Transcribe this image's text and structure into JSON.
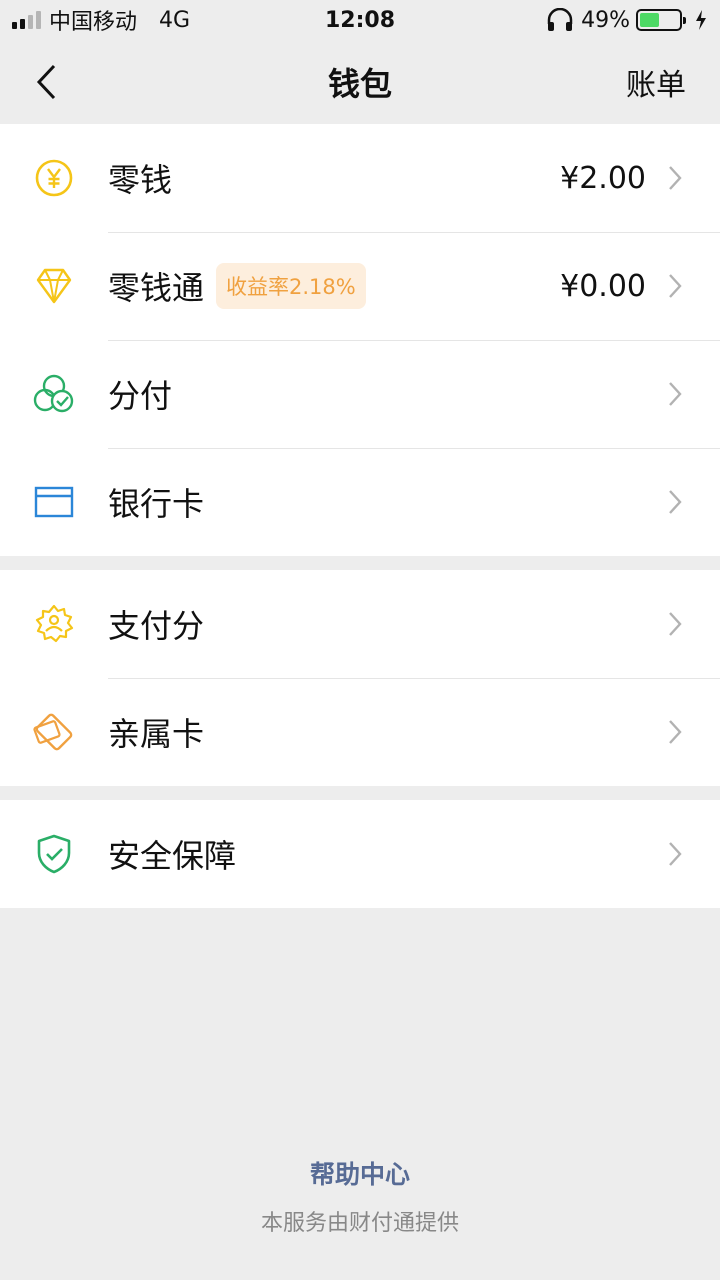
{
  "status_bar": {
    "carrier": "中国移动",
    "network": "4G",
    "time": "12:08",
    "battery": "49%",
    "battery_level": 0.49
  },
  "nav": {
    "title": "钱包",
    "right_label": "账单"
  },
  "groups": [
    {
      "items": [
        {
          "label": "零钱",
          "value": "¥2.00",
          "icon": "coin-yen-icon"
        },
        {
          "label": "零钱通",
          "badge": "收益率2.18%",
          "value": "¥0.00",
          "icon": "diamond-icon"
        },
        {
          "label": "分付",
          "icon": "fenfu-circles-icon"
        },
        {
          "label": "银行卡",
          "icon": "bank-card-icon"
        }
      ]
    },
    {
      "items": [
        {
          "label": "支付分",
          "icon": "pay-score-badge-icon"
        },
        {
          "label": "亲属卡",
          "icon": "family-card-icon"
        }
      ]
    },
    {
      "items": [
        {
          "label": "安全保障",
          "icon": "security-shield-icon"
        }
      ]
    }
  ],
  "footer": {
    "help": "帮助中心",
    "note": "本服务由财付通提供"
  },
  "colors": {
    "yellow": "#f5c518",
    "green": "#2aae67",
    "blue": "#2b86d8",
    "orange": "#f0a140",
    "link": "#576b95"
  }
}
